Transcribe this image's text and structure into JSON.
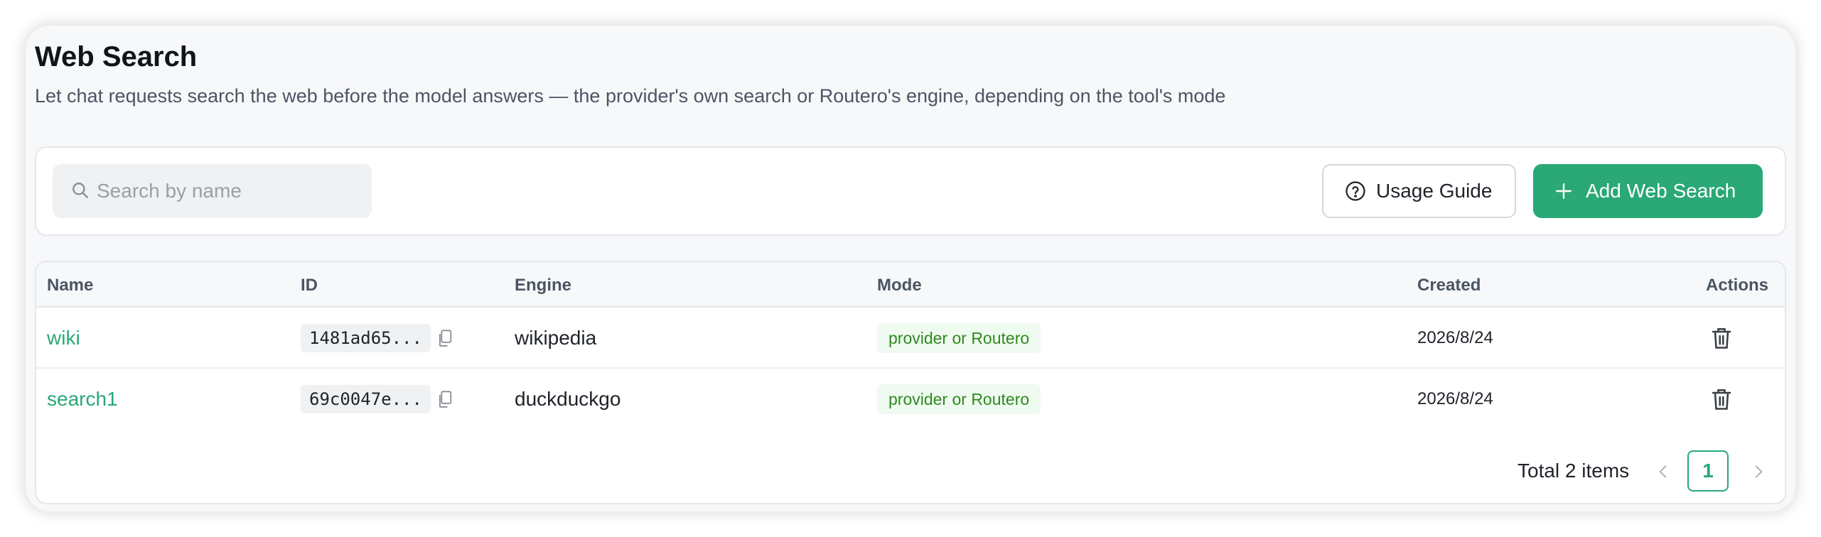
{
  "header": {
    "title": "Web Search",
    "description": "Let chat requests search the web before the model answers — the provider's own search or Routero's engine, depending on the tool's mode"
  },
  "toolbar": {
    "search_placeholder": "Search by name",
    "search_value": "",
    "search_icon": "search-icon",
    "usage_guide_label": "Usage Guide",
    "usage_guide_icon": "question-circle-icon",
    "add_label": "Add Web Search",
    "add_icon": "plus-icon"
  },
  "table": {
    "columns": {
      "name": "Name",
      "id": "ID",
      "engine": "Engine",
      "mode": "Mode",
      "created": "Created",
      "actions": "Actions"
    },
    "rows": [
      {
        "name": "wiki",
        "id": "1481ad65...",
        "engine": "wikipedia",
        "mode": "provider or Routero",
        "created": "2026/8/24"
      },
      {
        "name": "search1",
        "id": "69c0047e...",
        "engine": "duckduckgo",
        "mode": "provider or Routero",
        "created": "2026/8/24"
      }
    ]
  },
  "pagination": {
    "total_text": "Total 2 items",
    "current_page": "1"
  },
  "colors": {
    "accent": "#2aa876",
    "mode_tag_bg": "#effaf0",
    "mode_tag_text": "#2f8a1f"
  }
}
